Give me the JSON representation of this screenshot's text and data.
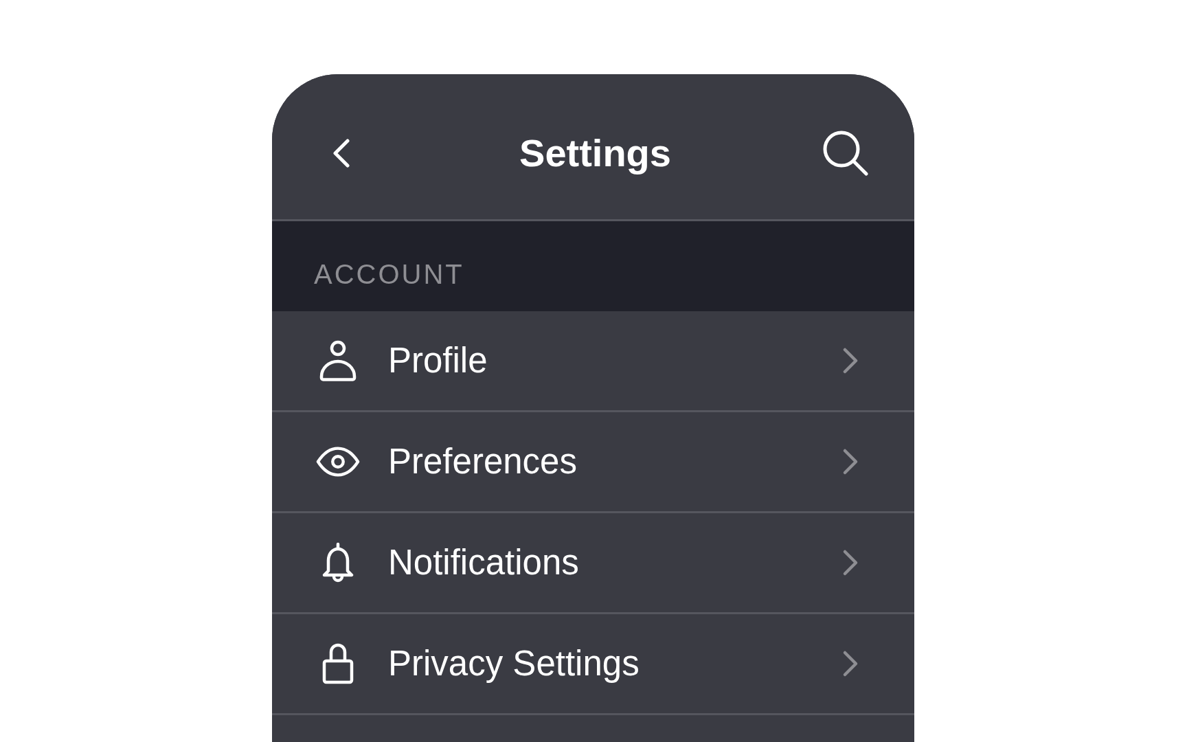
{
  "header": {
    "title": "Settings"
  },
  "sections": [
    {
      "heading": "ACCOUNT",
      "items": [
        {
          "label": "Profile"
        },
        {
          "label": "Preferences"
        },
        {
          "label": "Notifications"
        },
        {
          "label": "Privacy Settings"
        }
      ]
    }
  ]
}
